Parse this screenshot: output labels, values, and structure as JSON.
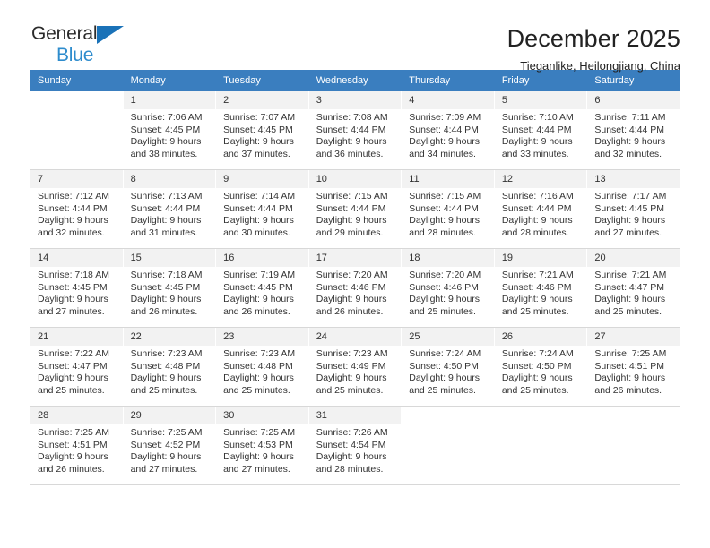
{
  "brand": {
    "name_part1": "General",
    "name_part2": "Blue",
    "triangle_color": "#1a72b8",
    "blue_text_color": "#2e8ccd"
  },
  "header": {
    "title": "December 2025",
    "subtitle": "Tieganlike, Heilongjiang, China"
  },
  "theme": {
    "header_row_bg": "#3a7ebf",
    "daynum_bg": "#f2f2f2",
    "text_color": "#333333"
  },
  "weekdays": [
    "Sunday",
    "Monday",
    "Tuesday",
    "Wednesday",
    "Thursday",
    "Friday",
    "Saturday"
  ],
  "labels": {
    "sunrise_prefix": "Sunrise:",
    "sunset_prefix": "Sunset:",
    "daylight_prefix": "Daylight:"
  },
  "weeks": [
    [
      {
        "day": ""
      },
      {
        "day": "1",
        "sunrise": "Sunrise: 7:06 AM",
        "sunset": "Sunset: 4:45 PM",
        "daylight": "Daylight: 9 hours and 38 minutes."
      },
      {
        "day": "2",
        "sunrise": "Sunrise: 7:07 AM",
        "sunset": "Sunset: 4:45 PM",
        "daylight": "Daylight: 9 hours and 37 minutes."
      },
      {
        "day": "3",
        "sunrise": "Sunrise: 7:08 AM",
        "sunset": "Sunset: 4:44 PM",
        "daylight": "Daylight: 9 hours and 36 minutes."
      },
      {
        "day": "4",
        "sunrise": "Sunrise: 7:09 AM",
        "sunset": "Sunset: 4:44 PM",
        "daylight": "Daylight: 9 hours and 34 minutes."
      },
      {
        "day": "5",
        "sunrise": "Sunrise: 7:10 AM",
        "sunset": "Sunset: 4:44 PM",
        "daylight": "Daylight: 9 hours and 33 minutes."
      },
      {
        "day": "6",
        "sunrise": "Sunrise: 7:11 AM",
        "sunset": "Sunset: 4:44 PM",
        "daylight": "Daylight: 9 hours and 32 minutes."
      }
    ],
    [
      {
        "day": "7",
        "sunrise": "Sunrise: 7:12 AM",
        "sunset": "Sunset: 4:44 PM",
        "daylight": "Daylight: 9 hours and 32 minutes."
      },
      {
        "day": "8",
        "sunrise": "Sunrise: 7:13 AM",
        "sunset": "Sunset: 4:44 PM",
        "daylight": "Daylight: 9 hours and 31 minutes."
      },
      {
        "day": "9",
        "sunrise": "Sunrise: 7:14 AM",
        "sunset": "Sunset: 4:44 PM",
        "daylight": "Daylight: 9 hours and 30 minutes."
      },
      {
        "day": "10",
        "sunrise": "Sunrise: 7:15 AM",
        "sunset": "Sunset: 4:44 PM",
        "daylight": "Daylight: 9 hours and 29 minutes."
      },
      {
        "day": "11",
        "sunrise": "Sunrise: 7:15 AM",
        "sunset": "Sunset: 4:44 PM",
        "daylight": "Daylight: 9 hours and 28 minutes."
      },
      {
        "day": "12",
        "sunrise": "Sunrise: 7:16 AM",
        "sunset": "Sunset: 4:44 PM",
        "daylight": "Daylight: 9 hours and 28 minutes."
      },
      {
        "day": "13",
        "sunrise": "Sunrise: 7:17 AM",
        "sunset": "Sunset: 4:45 PM",
        "daylight": "Daylight: 9 hours and 27 minutes."
      }
    ],
    [
      {
        "day": "14",
        "sunrise": "Sunrise: 7:18 AM",
        "sunset": "Sunset: 4:45 PM",
        "daylight": "Daylight: 9 hours and 27 minutes."
      },
      {
        "day": "15",
        "sunrise": "Sunrise: 7:18 AM",
        "sunset": "Sunset: 4:45 PM",
        "daylight": "Daylight: 9 hours and 26 minutes."
      },
      {
        "day": "16",
        "sunrise": "Sunrise: 7:19 AM",
        "sunset": "Sunset: 4:45 PM",
        "daylight": "Daylight: 9 hours and 26 minutes."
      },
      {
        "day": "17",
        "sunrise": "Sunrise: 7:20 AM",
        "sunset": "Sunset: 4:46 PM",
        "daylight": "Daylight: 9 hours and 26 minutes."
      },
      {
        "day": "18",
        "sunrise": "Sunrise: 7:20 AM",
        "sunset": "Sunset: 4:46 PM",
        "daylight": "Daylight: 9 hours and 25 minutes."
      },
      {
        "day": "19",
        "sunrise": "Sunrise: 7:21 AM",
        "sunset": "Sunset: 4:46 PM",
        "daylight": "Daylight: 9 hours and 25 minutes."
      },
      {
        "day": "20",
        "sunrise": "Sunrise: 7:21 AM",
        "sunset": "Sunset: 4:47 PM",
        "daylight": "Daylight: 9 hours and 25 minutes."
      }
    ],
    [
      {
        "day": "21",
        "sunrise": "Sunrise: 7:22 AM",
        "sunset": "Sunset: 4:47 PM",
        "daylight": "Daylight: 9 hours and 25 minutes."
      },
      {
        "day": "22",
        "sunrise": "Sunrise: 7:23 AM",
        "sunset": "Sunset: 4:48 PM",
        "daylight": "Daylight: 9 hours and 25 minutes."
      },
      {
        "day": "23",
        "sunrise": "Sunrise: 7:23 AM",
        "sunset": "Sunset: 4:48 PM",
        "daylight": "Daylight: 9 hours and 25 minutes."
      },
      {
        "day": "24",
        "sunrise": "Sunrise: 7:23 AM",
        "sunset": "Sunset: 4:49 PM",
        "daylight": "Daylight: 9 hours and 25 minutes."
      },
      {
        "day": "25",
        "sunrise": "Sunrise: 7:24 AM",
        "sunset": "Sunset: 4:50 PM",
        "daylight": "Daylight: 9 hours and 25 minutes."
      },
      {
        "day": "26",
        "sunrise": "Sunrise: 7:24 AM",
        "sunset": "Sunset: 4:50 PM",
        "daylight": "Daylight: 9 hours and 25 minutes."
      },
      {
        "day": "27",
        "sunrise": "Sunrise: 7:25 AM",
        "sunset": "Sunset: 4:51 PM",
        "daylight": "Daylight: 9 hours and 26 minutes."
      }
    ],
    [
      {
        "day": "28",
        "sunrise": "Sunrise: 7:25 AM",
        "sunset": "Sunset: 4:51 PM",
        "daylight": "Daylight: 9 hours and 26 minutes."
      },
      {
        "day": "29",
        "sunrise": "Sunrise: 7:25 AM",
        "sunset": "Sunset: 4:52 PM",
        "daylight": "Daylight: 9 hours and 27 minutes."
      },
      {
        "day": "30",
        "sunrise": "Sunrise: 7:25 AM",
        "sunset": "Sunset: 4:53 PM",
        "daylight": "Daylight: 9 hours and 27 minutes."
      },
      {
        "day": "31",
        "sunrise": "Sunrise: 7:26 AM",
        "sunset": "Sunset: 4:54 PM",
        "daylight": "Daylight: 9 hours and 28 minutes."
      },
      {
        "day": ""
      },
      {
        "day": ""
      },
      {
        "day": ""
      }
    ]
  ]
}
